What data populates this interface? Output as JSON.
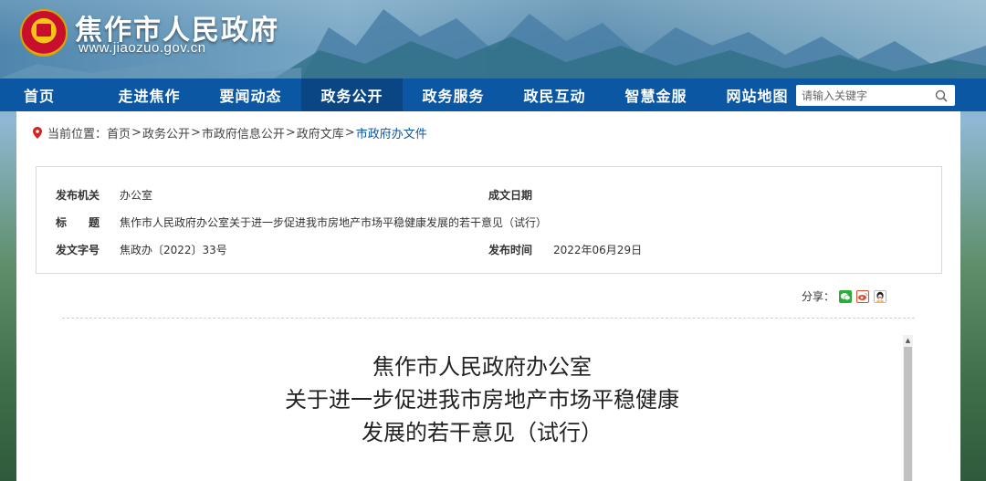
{
  "header": {
    "site_title": "焦作市人民政府",
    "site_url": "www.jiaozuo.gov.cn",
    "emblem_icon": "national-emblem-icon"
  },
  "nav": {
    "items": [
      {
        "label": "首页"
      },
      {
        "label": "走进焦作"
      },
      {
        "label": "要闻动态"
      },
      {
        "label": "政务公开"
      },
      {
        "label": "政务服务"
      },
      {
        "label": "政民互动"
      },
      {
        "label": "智慧金服"
      },
      {
        "label": "网站地图"
      }
    ],
    "active_index": 3,
    "search_placeholder": "请输入关键字",
    "bg_color": "#0b57a4"
  },
  "breadcrumb": {
    "prefix": "当前位置：",
    "items": [
      "首页",
      "政务公开",
      "市政府信息公开",
      "政府文库"
    ],
    "current": "市政府办文件",
    "separator": ">"
  },
  "info": {
    "publisher_label": "发布机关",
    "publisher_value": "办公室",
    "date_written_label": "成文日期",
    "date_written_value": "",
    "title_label": "标　　题",
    "title_value": "焦作市人民政府办公室关于进一步促进我市房地产市场平稳健康发展的若干意见（试行）",
    "doc_no_label": "发文字号",
    "doc_no_value": "焦政办〔2022〕33号",
    "publish_time_label": "发布时间",
    "publish_time_value": "2022年06月29日"
  },
  "share": {
    "label": "分享：",
    "icons": [
      "wechat-icon",
      "weibo-icon",
      "qq-icon"
    ]
  },
  "document": {
    "title_line1": "焦作市人民政府办公室",
    "title_line2": "关于进一步促进我市房地产市场平稳健康",
    "title_line3": "发展的若干意见（试行）"
  }
}
